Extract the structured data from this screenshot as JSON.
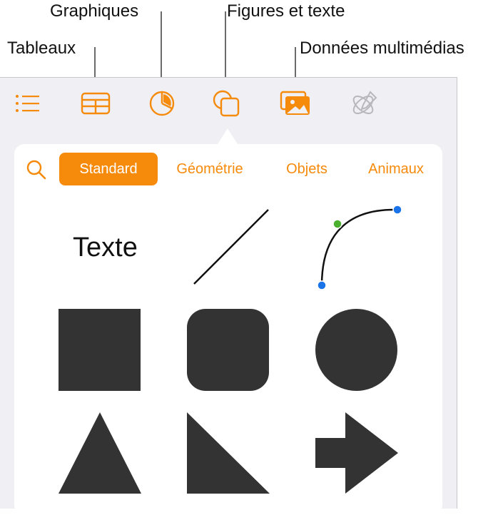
{
  "callouts": {
    "graphiques": "Graphiques",
    "figures": "Figures et texte",
    "tableaux": "Tableaux",
    "medias": "Données multimédias"
  },
  "toolbar": {
    "icons": [
      "list-icon",
      "table-icon",
      "chart-icon",
      "shapes-icon",
      "media-icon",
      "drawing-icon"
    ],
    "accent": "#f58a0b",
    "inactive": "#b8b8bc"
  },
  "tabs": {
    "items": [
      {
        "label": "Standard",
        "active": true
      },
      {
        "label": "Géométrie",
        "active": false
      },
      {
        "label": "Objets",
        "active": false
      },
      {
        "label": "Animaux",
        "active": false
      }
    ]
  },
  "shapes": {
    "text_label": "Texte",
    "fill": "#333333",
    "items": [
      "text",
      "line",
      "curve",
      "square",
      "rounded-square",
      "circle",
      "triangle",
      "right-triangle",
      "arrow"
    ]
  }
}
